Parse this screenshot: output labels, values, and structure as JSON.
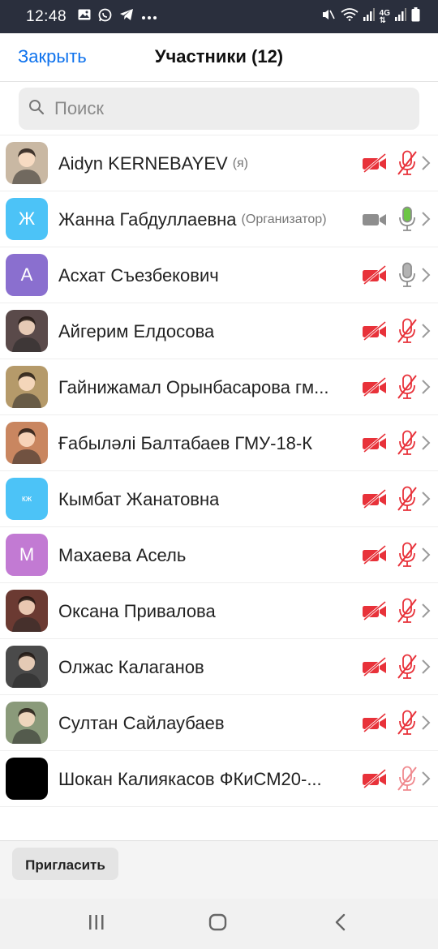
{
  "status_bar": {
    "time": "12:48",
    "left_icons": [
      "gallery-icon",
      "whatsapp-icon",
      "telegram-icon",
      "more-dots-icon"
    ],
    "right_icons": [
      "mute-icon",
      "wifi-icon",
      "signal-icon",
      "4g-icon",
      "signal2-icon",
      "battery-icon"
    ],
    "network_label": "4G"
  },
  "header": {
    "close_label": "Закрыть",
    "title": "Участники (12)"
  },
  "search": {
    "placeholder": "Поиск"
  },
  "participants": [
    {
      "name": "Aidyn KERNEBAYEV",
      "role": "(я)",
      "avatar_type": "photo",
      "avatar_color": "#c9b8a3",
      "video": "off",
      "mic": "muted"
    },
    {
      "name": "Жанна Габдуллаевна",
      "role": "(Организатор)",
      "avatar_type": "letter",
      "avatar_letter": "Ж",
      "avatar_color": "#4cc3f7",
      "video": "on",
      "mic": "active"
    },
    {
      "name": "Асхат Съезбекович",
      "role": "",
      "avatar_type": "letter",
      "avatar_letter": "А",
      "avatar_color": "#8a6fcf",
      "video": "off",
      "mic": "neutral"
    },
    {
      "name": "Айгерим Елдосова",
      "role": "",
      "avatar_type": "photo",
      "avatar_color": "#5a4a4a",
      "video": "off",
      "mic": "muted"
    },
    {
      "name": "Гайнижамал Орынбасарова гм...",
      "role": "",
      "avatar_type": "photo",
      "avatar_color": "#b59a6a",
      "video": "off",
      "mic": "muted"
    },
    {
      "name": "Ғабыләлі Балтабаев ГМУ-18-К",
      "role": "",
      "avatar_type": "photo",
      "avatar_color": "#c98660",
      "video": "off",
      "mic": "muted"
    },
    {
      "name": "Кымбат Жанатовна",
      "role": "",
      "avatar_type": "letter",
      "avatar_letter": "кж",
      "avatar_color": "#4cc3f7",
      "video": "off",
      "mic": "muted"
    },
    {
      "name": "Махаева Асель",
      "role": "",
      "avatar_type": "letter",
      "avatar_letter": "М",
      "avatar_color": "#c27ad3",
      "video": "off",
      "mic": "muted"
    },
    {
      "name": "Оксана Привалова",
      "role": "",
      "avatar_type": "photo",
      "avatar_color": "#6b3a32",
      "video": "off",
      "mic": "muted"
    },
    {
      "name": "Олжас Калаганов",
      "role": "",
      "avatar_type": "photo",
      "avatar_color": "#4a4a4a",
      "video": "off",
      "mic": "muted"
    },
    {
      "name": "Султан Сайлаубаев",
      "role": "",
      "avatar_type": "photo",
      "avatar_color": "#8a9a7a",
      "video": "off",
      "mic": "muted"
    },
    {
      "name": "Шокан Калиякасов ФКиСМ20-...",
      "role": "",
      "avatar_type": "photo",
      "avatar_color": "#000000",
      "video": "off",
      "mic": "muted_light"
    }
  ],
  "footer": {
    "invite_label": "Пригласить"
  },
  "navbar": {
    "buttons": [
      "recent-apps-icon",
      "home-icon",
      "back-icon"
    ]
  },
  "colors": {
    "accent": "#0e72ed",
    "muted_red": "#e8323a",
    "mic_green": "#6cc644",
    "neutral_gray": "#8e8e8e"
  }
}
